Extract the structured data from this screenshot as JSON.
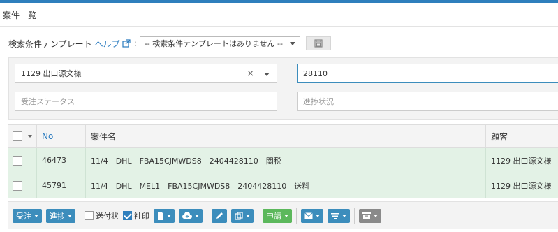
{
  "page": {
    "title": "案件一覧"
  },
  "template": {
    "label": "検索条件テンプレート",
    "help": "ヘルプ",
    "colon": ":",
    "select_value": "-- 検索条件テンプレートはありません --"
  },
  "filters": {
    "customer_value": "1129 出口源文様",
    "search_value": "28110",
    "order_status_placeholder": "受注ステータス",
    "progress_placeholder": "進捗状況"
  },
  "table": {
    "headers": {
      "no": "No",
      "name": "案件名",
      "customer": "顧客"
    },
    "rows": [
      {
        "no": "46473",
        "name": "11/4　DHL　FBA15CJMWDS8　2404428110　関税",
        "customer": "1129 出口源文様"
      },
      {
        "no": "45791",
        "name": "11/4　DHL　MEL1　FBA15CJMWDS8　2404428110　送料",
        "customer": "1129 出口源文様"
      }
    ]
  },
  "toolbar": {
    "order": "受注",
    "progress": "進捗",
    "invoice": "送付状",
    "company_seal": "社印",
    "apply": "申請"
  },
  "colors": {
    "accent": "#3c8dbc",
    "green": "#5cb85c",
    "row_bg": "#e3f2e6"
  }
}
